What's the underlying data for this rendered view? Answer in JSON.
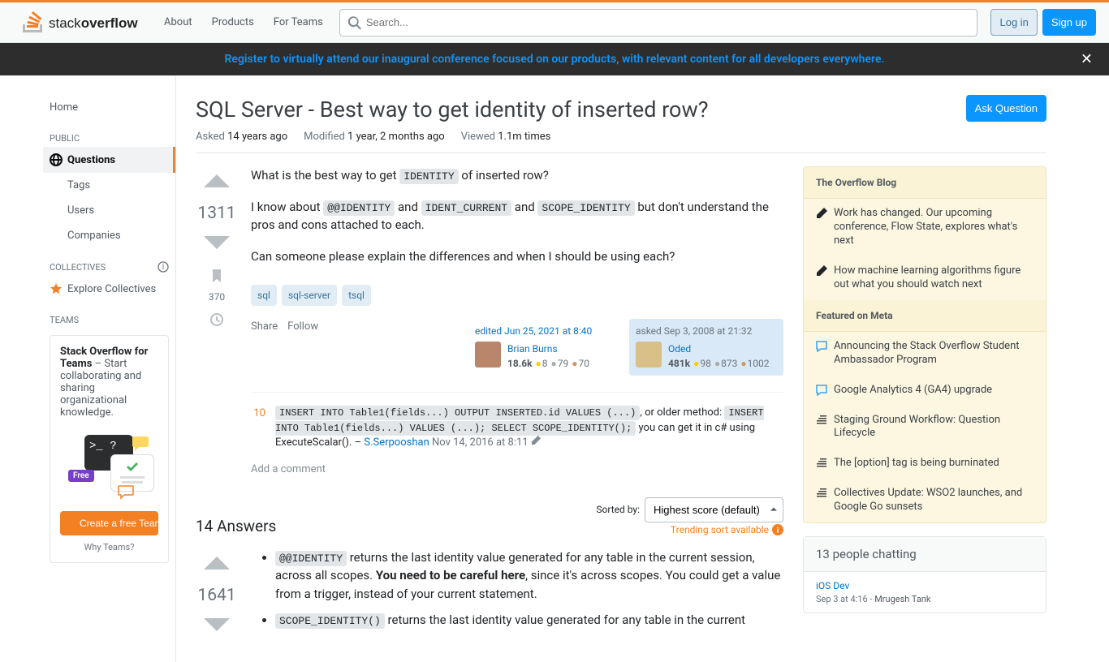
{
  "header": {
    "nav": [
      "About",
      "Products",
      "For Teams"
    ],
    "search_placeholder": "Search...",
    "login": "Log in",
    "signup": "Sign up"
  },
  "announce": {
    "text": "Register to virtually attend our inaugural conference focused on our products, with relevant content for all developers everywhere."
  },
  "leftnav": {
    "home": "Home",
    "public_label": "PUBLIC",
    "questions": "Questions",
    "tags": "Tags",
    "users": "Users",
    "companies": "Companies",
    "collectives_label": "COLLECTIVES",
    "explore_collectives": "Explore Collectives",
    "teams_label": "TEAMS",
    "teams_card_title": "Stack Overflow for Teams",
    "teams_card_text": " – Start collaborating and sharing organizational knowledge.",
    "free_badge": "Free",
    "prompt": ">_ ?",
    "create_team": "Create a free Team",
    "why_teams": "Why Teams?"
  },
  "question": {
    "title": "SQL Server - Best way to get identity of inserted row?",
    "ask_button": "Ask Question",
    "asked_label": "Asked",
    "asked_value": "14 years ago",
    "modified_label": "Modified",
    "modified_value": "1 year, 2 months ago",
    "viewed_label": "Viewed",
    "viewed_value": "1.1m times",
    "vote_count": "1311",
    "bookmark_count": "370",
    "body": {
      "p1_a": "What is the best way to get ",
      "p1_code": "IDENTITY",
      "p1_b": " of inserted row?",
      "p2_a": "I know about ",
      "p2_code1": "@@IDENTITY",
      "p2_b": " and ",
      "p2_code2": "IDENT_CURRENT",
      "p2_c": " and ",
      "p2_code3": "SCOPE_IDENTITY",
      "p2_d": " but don't understand the pros and cons attached to each.",
      "p3": "Can someone please explain the differences and when I should be using each?"
    },
    "tags": [
      "sql",
      "sql-server",
      "tsql"
    ],
    "actions": {
      "share": "Share",
      "follow": "Follow"
    },
    "editor": {
      "time_label": "edited Jun 25, 2021 at 8:40",
      "name": "Brian Burns",
      "rep": "18.6k",
      "gold": "8",
      "silver": "79",
      "bronze": "70"
    },
    "owner": {
      "time_label": "asked Sep 3, 2008 at 21:32",
      "name": "Oded",
      "rep": "481k",
      "gold": "98",
      "silver": "873",
      "bronze": "1002"
    },
    "comment": {
      "score": "10",
      "code1": "INSERT INTO Table1(fields...) OUTPUT INSERTED.id VALUES (...)",
      "mid1": ", or older method: ",
      "code2": "INSERT INTO Table1(fields...) VALUES (...); SELECT SCOPE_IDENTITY();",
      "mid2": " you can get it in c# using ExecuteScalar(). – ",
      "user": "S.Serpooshan",
      "date": "Nov 14, 2016 at 8:11"
    },
    "add_comment": "Add a comment"
  },
  "answers": {
    "count_label": "14 Answers",
    "sorted_by": "Sorted by:",
    "trending": "Trending sort available",
    "sort_value": "Highest score (default)",
    "top": {
      "vote_count": "1641",
      "li1_code": "@@IDENTITY",
      "li1_a": " returns the last identity value generated for any table in the current session, across all scopes. ",
      "li1_bold": "You need to be careful here",
      "li1_b": ", since it's across scopes. You could get a value from a trigger, instead of your current statement.",
      "li2_code": "SCOPE_IDENTITY()",
      "li2_a": " returns the last identity value generated for any table in the current"
    }
  },
  "sidebar": {
    "blog_header": "The Overflow Blog",
    "blog_items": [
      "Work has changed. Our upcoming conference, Flow State, explores what's next",
      "How machine learning algorithms figure out what you should watch next"
    ],
    "meta_header": "Featured on Meta",
    "meta_items": [
      "Announcing the Stack Overflow Student Ambassador Program",
      "Google Analytics 4 (GA4) upgrade",
      "Staging Ground Workflow: Question Lifecycle",
      "The [option] tag is being burninated",
      "Collectives Update: WSO2 launches, and Google Go sunsets"
    ],
    "chat_header": "13 people chatting",
    "chat_room": "iOS Dev",
    "chat_meta_time": "Sep 3 at 4:16 - ",
    "chat_meta_user": "Mrugesh Tank"
  }
}
